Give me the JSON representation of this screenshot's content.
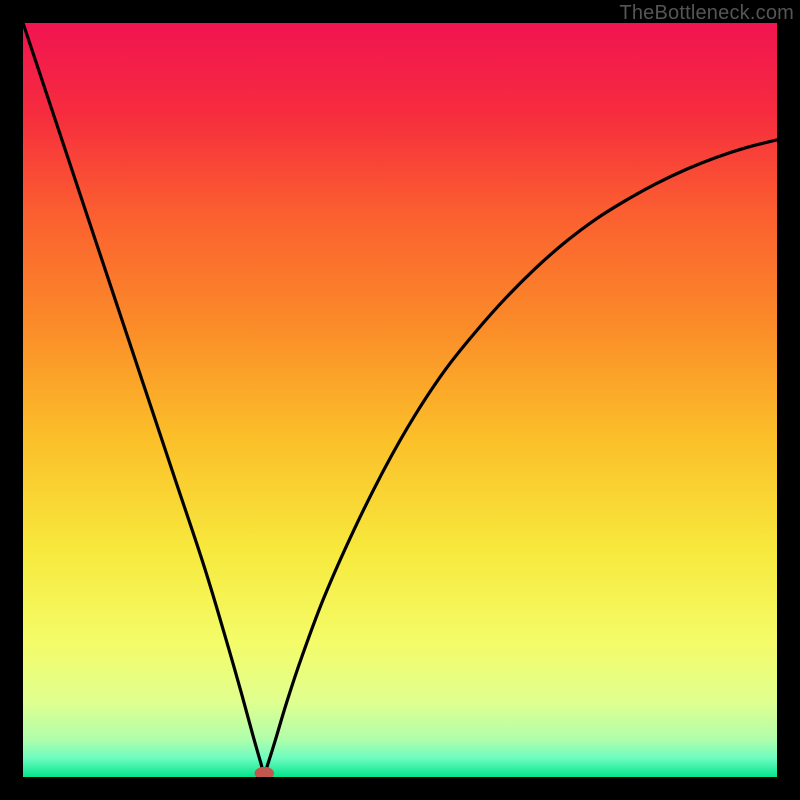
{
  "attribution": "TheBottleneck.com",
  "chart_data": {
    "type": "line",
    "title": "",
    "xlabel": "",
    "ylabel": "",
    "xlim": [
      0,
      100
    ],
    "ylim": [
      0,
      100
    ],
    "minimum_x": 32,
    "marker": {
      "x": 32,
      "y": 0,
      "color": "#c1584f"
    },
    "gradient_stops": [
      {
        "offset": 0.0,
        "color": "#f11451"
      },
      {
        "offset": 0.12,
        "color": "#f62c3e"
      },
      {
        "offset": 0.25,
        "color": "#fb5e30"
      },
      {
        "offset": 0.4,
        "color": "#fb8b29"
      },
      {
        "offset": 0.55,
        "color": "#fbbf29"
      },
      {
        "offset": 0.7,
        "color": "#f7e93d"
      },
      {
        "offset": 0.82,
        "color": "#f4fc68"
      },
      {
        "offset": 0.9,
        "color": "#e0ff8f"
      },
      {
        "offset": 0.95,
        "color": "#b0feab"
      },
      {
        "offset": 0.975,
        "color": "#6dfcc0"
      },
      {
        "offset": 1.0,
        "color": "#04e58b"
      }
    ],
    "series": [
      {
        "name": "curve",
        "x": [
          0,
          4,
          8,
          12,
          16,
          20,
          24,
          27,
          29,
          30.5,
          31.5,
          32,
          32.5,
          33.5,
          35,
          37,
          40,
          44,
          48,
          52,
          56,
          60,
          64,
          68,
          72,
          76,
          80,
          84,
          88,
          92,
          96,
          100
        ],
        "y": [
          100,
          88,
          76,
          64,
          52,
          40,
          28,
          18,
          11,
          5.5,
          2.0,
          0.4,
          1.8,
          5.0,
          10,
          16,
          24,
          33,
          41,
          48,
          54,
          59,
          63.5,
          67.5,
          71,
          74,
          76.5,
          78.7,
          80.6,
          82.2,
          83.5,
          84.5
        ]
      }
    ]
  }
}
